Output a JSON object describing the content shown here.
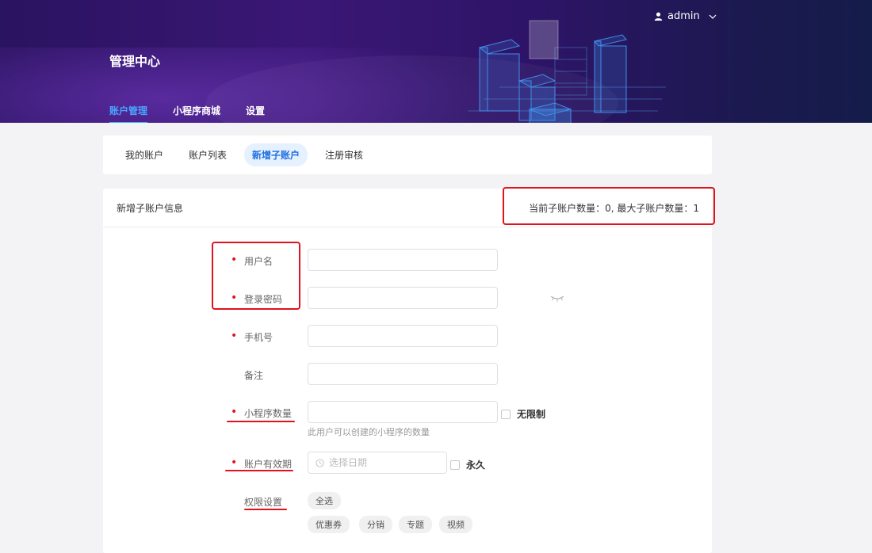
{
  "header": {
    "brand": "管理中心",
    "user": "admin",
    "nav": [
      {
        "label": "账户管理",
        "active": true
      },
      {
        "label": "小程序商城",
        "active": false
      },
      {
        "label": "设置",
        "active": false
      }
    ]
  },
  "tabs": [
    {
      "label": "我的账户",
      "active": false
    },
    {
      "label": "账户列表",
      "active": false
    },
    {
      "label": "新增子账户",
      "active": true
    },
    {
      "label": "注册审核",
      "active": false
    }
  ],
  "card": {
    "title": "新增子账户信息",
    "count_text": "当前子账户数量：0, 最大子账户数量：1"
  },
  "form": {
    "username_label": "用户名",
    "password_label": "登录密码",
    "phone_label": "手机号",
    "remark_label": "备注",
    "mp_count_label": "小程序数量",
    "mp_count_hint": "此用户可以创建的小程序的数量",
    "unlimited_label": "无限制",
    "expiry_label": "账户有效期",
    "date_placeholder": "选择日期",
    "forever_label": "永久",
    "perm_label": "权限设置",
    "select_all": "全选",
    "permissions": [
      "优惠券",
      "分销",
      "专题",
      "视频"
    ]
  },
  "colors": {
    "header_bg": "#2a1360",
    "accent": "#4aa3ff",
    "tab_active_bg": "#e6f1ff",
    "tab_active_text": "#1f6fe0",
    "required_dot": "#e0121d",
    "annotation": "#e0121d"
  },
  "icons": {
    "user": "user-icon",
    "chevron": "chevron-down-icon",
    "eye": "eye-closed-icon",
    "clock": "clock-icon"
  }
}
